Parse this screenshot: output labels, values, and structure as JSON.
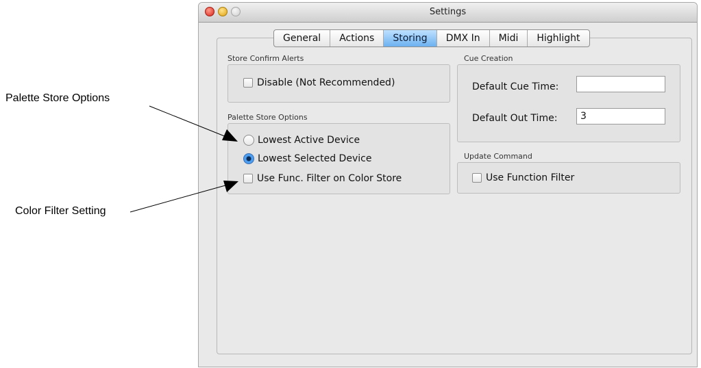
{
  "callouts": {
    "palette": "Palette Store Options",
    "color": "Color Filter Setting"
  },
  "window": {
    "title": "Settings"
  },
  "tabs": [
    "General",
    "Actions",
    "Storing",
    "DMX In",
    "Midi",
    "Highlight"
  ],
  "active_tab": "Storing",
  "store_confirm": {
    "label": "Store Confirm Alerts",
    "disable_label": "Disable (Not Recommended)",
    "disable_checked": false
  },
  "palette_store": {
    "label": "Palette Store Options",
    "option1": "Lowest Active Device",
    "option2": "Lowest Selected Device",
    "selected": "Lowest Selected Device",
    "func_filter_label": "Use Func. Filter on Color Store",
    "func_filter_checked": false
  },
  "cue_creation": {
    "label": "Cue Creation",
    "default_cue_time_label": "Default Cue Time:",
    "default_cue_time_value": "",
    "default_out_time_label": "Default Out Time:",
    "default_out_time_value": "3"
  },
  "update_command": {
    "label": "Update Command",
    "use_function_filter_label": "Use Function Filter",
    "use_function_filter_checked": false
  }
}
